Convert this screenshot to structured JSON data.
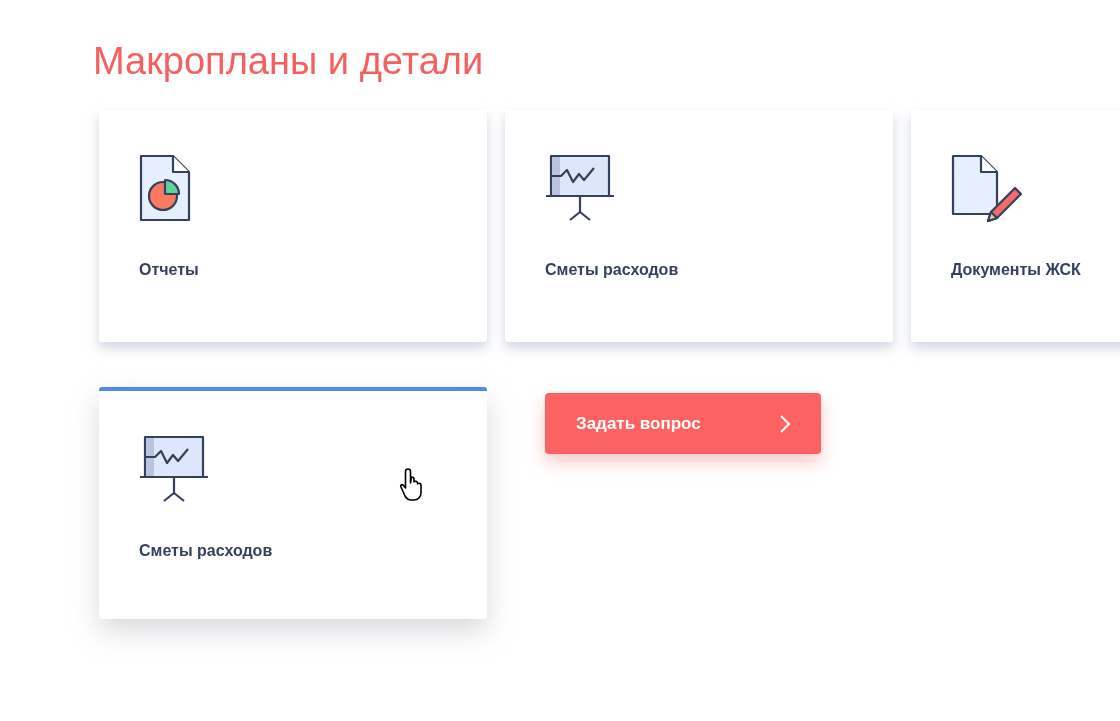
{
  "title": "Макропланы и детали",
  "cards": [
    {
      "label": "Отчеты",
      "kind": "report",
      "hovered": false
    },
    {
      "label": "Сметы расходов",
      "kind": "presentation",
      "hovered": false
    },
    {
      "label": "Документы ЖСК",
      "kind": "document",
      "hovered": false
    },
    {
      "label": "Сметы расходов",
      "kind": "presentation",
      "hovered": true
    }
  ],
  "ask_button": {
    "label": "Задать вопрос"
  }
}
